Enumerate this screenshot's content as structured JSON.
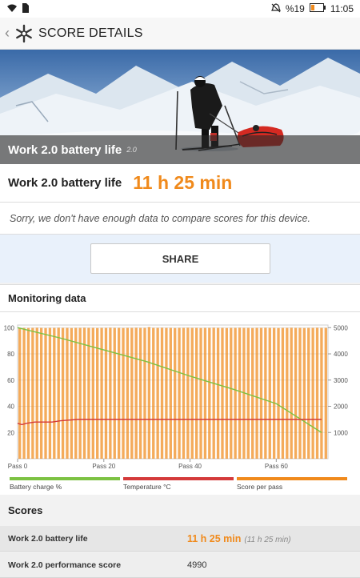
{
  "status_bar": {
    "battery_percent": "%19",
    "time": "11:05",
    "icons": [
      "wifi-icon",
      "sim-icon",
      "mute-icon",
      "battery-icon"
    ]
  },
  "app_bar": {
    "title": "SCORE DETAILS",
    "icons": [
      "back-icon",
      "logo-icon"
    ]
  },
  "hero": {
    "title": "Work 2.0 battery life",
    "version": "2.0"
  },
  "result": {
    "label": "Work 2.0 battery life",
    "value": "11 h 25 min"
  },
  "compare_note": "Sorry, we don't have enough data to compare scores for this device.",
  "share_label": "SHARE",
  "monitoring": {
    "title": "Monitoring data",
    "legend": [
      {
        "label": "Battery charge %",
        "color": "#7cc242"
      },
      {
        "label": "Temperature °C",
        "color": "#d43a3a"
      },
      {
        "label": "Score per pass",
        "color": "#f08a1c"
      }
    ]
  },
  "scores": {
    "title": "Scores",
    "rows": [
      {
        "label": "Work 2.0 battery life",
        "value": "11 h 25 min",
        "sub": "(11 h 25 min)"
      },
      {
        "label": "Work 2.0 performance score",
        "value": "4990"
      }
    ]
  },
  "chart_data": {
    "type": "bar",
    "x_tick_labels": [
      "Pass 0",
      "Pass 20",
      "Pass 40",
      "Pass 60"
    ],
    "x_ticks": [
      0,
      20,
      40,
      60
    ],
    "x_range": [
      0,
      72
    ],
    "left_axis": {
      "ticks": [
        20,
        40,
        60,
        80,
        100
      ],
      "range": [
        0,
        102
      ]
    },
    "right_axis": {
      "ticks": [
        1000,
        2000,
        3000,
        4000,
        5000
      ],
      "range": [
        0,
        5100
      ]
    },
    "grid": true,
    "legend_position": "bottom",
    "series": [
      {
        "name": "Score per pass",
        "type": "bar",
        "axis": "right",
        "color": "#f08a1c",
        "x": [
          0,
          1,
          2,
          3,
          4,
          5,
          6,
          7,
          8,
          9,
          10,
          11,
          12,
          13,
          14,
          15,
          16,
          17,
          18,
          19,
          20,
          21,
          22,
          23,
          24,
          25,
          26,
          27,
          28,
          29,
          30,
          31,
          32,
          33,
          34,
          35,
          36,
          37,
          38,
          39,
          40,
          41,
          42,
          43,
          44,
          45,
          46,
          47,
          48,
          49,
          50,
          51,
          52,
          53,
          54,
          55,
          56,
          57,
          58,
          59,
          60,
          61,
          62,
          63,
          64,
          65,
          66,
          67,
          68,
          69,
          70,
          71
        ],
        "values": [
          4990,
          4990,
          4985,
          4990,
          4995,
          4990,
          4985,
          4990,
          4990,
          4995,
          4990,
          4990,
          4985,
          4990,
          4990,
          4995,
          4990,
          4990,
          4985,
          4990,
          4990,
          4995,
          4990,
          4990,
          4985,
          4990,
          4990,
          4995,
          4990,
          4990,
          5020,
          4990,
          4990,
          4995,
          4990,
          4990,
          4985,
          4990,
          4990,
          4995,
          4990,
          4990,
          4985,
          4990,
          4990,
          4995,
          4990,
          4990,
          4985,
          4990,
          4990,
          4995,
          4990,
          4990,
          4985,
          4990,
          4990,
          4995,
          4990,
          4990,
          4985,
          4990,
          4990,
          4995,
          4990,
          4990,
          4985,
          4990,
          4990,
          4995,
          4990,
          4990
        ]
      },
      {
        "name": "Battery charge %",
        "type": "line",
        "axis": "left",
        "color": "#7cc242",
        "x": [
          0,
          10,
          20,
          30,
          40,
          50,
          60,
          70.5
        ],
        "values": [
          100,
          92,
          83,
          74,
          63,
          53,
          42,
          20
        ]
      },
      {
        "name": "Temperature °C",
        "type": "line",
        "axis": "left",
        "color": "#d43a3a",
        "x": [
          0,
          1,
          2,
          4,
          6,
          8,
          10,
          14,
          20,
          30,
          40,
          50,
          60,
          70.5
        ],
        "values": [
          27,
          26,
          27,
          28,
          28,
          28,
          29,
          30,
          30,
          30,
          30,
          30,
          30,
          30
        ]
      }
    ]
  }
}
